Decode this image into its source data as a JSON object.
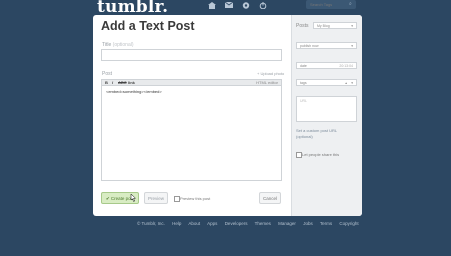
{
  "header": {
    "logo": "tumblr.",
    "icons": [
      "home-icon",
      "mail-icon",
      "settings-icon",
      "power-icon"
    ],
    "search_placeholder": "Search Tags"
  },
  "post": {
    "title": "Add a Text Post",
    "title_label": "Title",
    "title_optional": "(optional)",
    "post_label": "Post",
    "upload_label": "+ Upload photo",
    "toolbar": {
      "bold": "B",
      "italic": "I",
      "strike": "ABC",
      "link": "link",
      "html": "HTML editor"
    },
    "body_text": "<embed=something></embed>",
    "create_label": "✔ Create post",
    "preview_label": "Preview",
    "preview_checkbox_label": "Preview this post",
    "cancel_label": "Cancel"
  },
  "sidebar": {
    "posts_label": "Posts",
    "blog_select": "My Blog",
    "publish_select": "publish now",
    "date_label": "date",
    "date_value": "20:13:04",
    "tags_label": "tags",
    "url_placeholder": "URL",
    "custom_url_line1": "Set a custom post URL",
    "custom_url_line2": "(optional)",
    "share_label": "Let people share this"
  },
  "footer": {
    "links": [
      "© Tumblr, Inc.",
      "Help",
      "About",
      "Apps",
      "Developers",
      "Themes",
      "Manager",
      "Jobs",
      "Terms",
      "Copyright"
    ]
  },
  "colors": {
    "background": "#2c4762",
    "panel": "#ffffff",
    "create_button": "#d8ecc3"
  }
}
